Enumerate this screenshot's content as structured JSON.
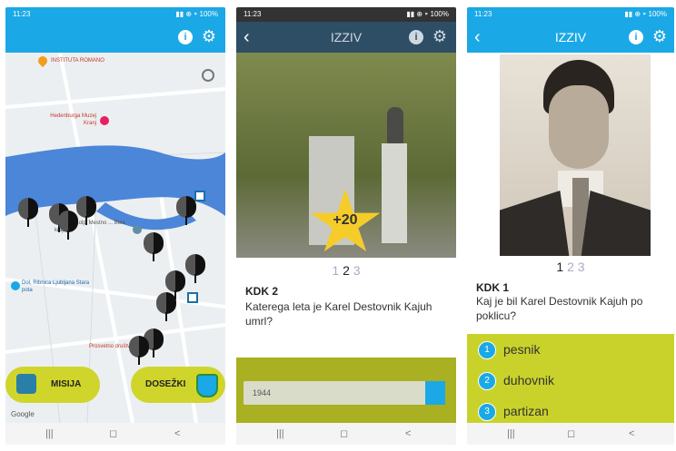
{
  "phone1": {
    "status_time": "11:23",
    "status_right": "▮▮ ⊕ ⁍ 100%",
    "map_labels": {
      "top_place": "INSTITUTA ROMANO",
      "museum": "Hedenburga Muzej Kranj",
      "middle": "Dom ob Kolpi Mestno ... Bela krajina",
      "lower_left": "Dol, Ribnica Ljubljana Stara pota",
      "lower_right": "Prosvetno društvo",
      "google": "Google"
    },
    "buttons": {
      "mission": "MISIJA",
      "achievements": "DOSEŽKI"
    },
    "nav": {
      "recent": "|||",
      "home": "◻",
      "back": "<"
    }
  },
  "phone2": {
    "status_time": "11:23",
    "status_right": "▮▮ ⊕ ⁍ 100%",
    "title": "IZZIV",
    "points_badge": "+20",
    "pager": [
      "1",
      "2",
      "3"
    ],
    "question_label": "KDK 2",
    "question_text": "Katerega leta je Karel Destovnik Kajuh umrl?",
    "answer_value": "1944",
    "nav": {
      "recent": "|||",
      "home": "◻",
      "back": "<"
    }
  },
  "phone3": {
    "status_time": "11:23",
    "status_right": "▮▮ ⊕ ⁍ 100%",
    "title": "IZZIV",
    "pager": [
      "1",
      "2",
      "3"
    ],
    "question_label": "KDK 1",
    "question_text": "Kaj je bil Karel Destovnik Kajuh po poklicu?",
    "answers": [
      {
        "num": "1",
        "label": "pesnik"
      },
      {
        "num": "2",
        "label": "duhovnik"
      },
      {
        "num": "3",
        "label": "partizan"
      }
    ],
    "nav": {
      "recent": "|||",
      "home": "◻",
      "back": "<"
    }
  },
  "colors": {
    "accent": "#1ba8e6",
    "button_yellow": "#c9d22a",
    "river": "#4b86d9"
  }
}
